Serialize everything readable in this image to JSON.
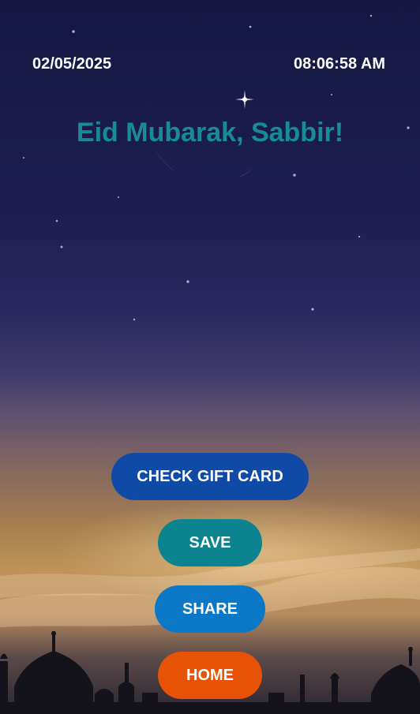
{
  "header": {
    "date": "02/05/2025",
    "time": "08:06:58 AM"
  },
  "greeting": "Eid Mubarak, Sabbir!",
  "buttons": {
    "check_gift_card": "CHECK GIFT CARD",
    "save": "SAVE",
    "share": "SHARE",
    "home": "HOME"
  },
  "colors": {
    "greeting_text": "#178c96",
    "gift_button": "#0e4aa6",
    "save_button": "#0b8490",
    "share_button": "#0a78c6",
    "home_button": "#e85207"
  }
}
